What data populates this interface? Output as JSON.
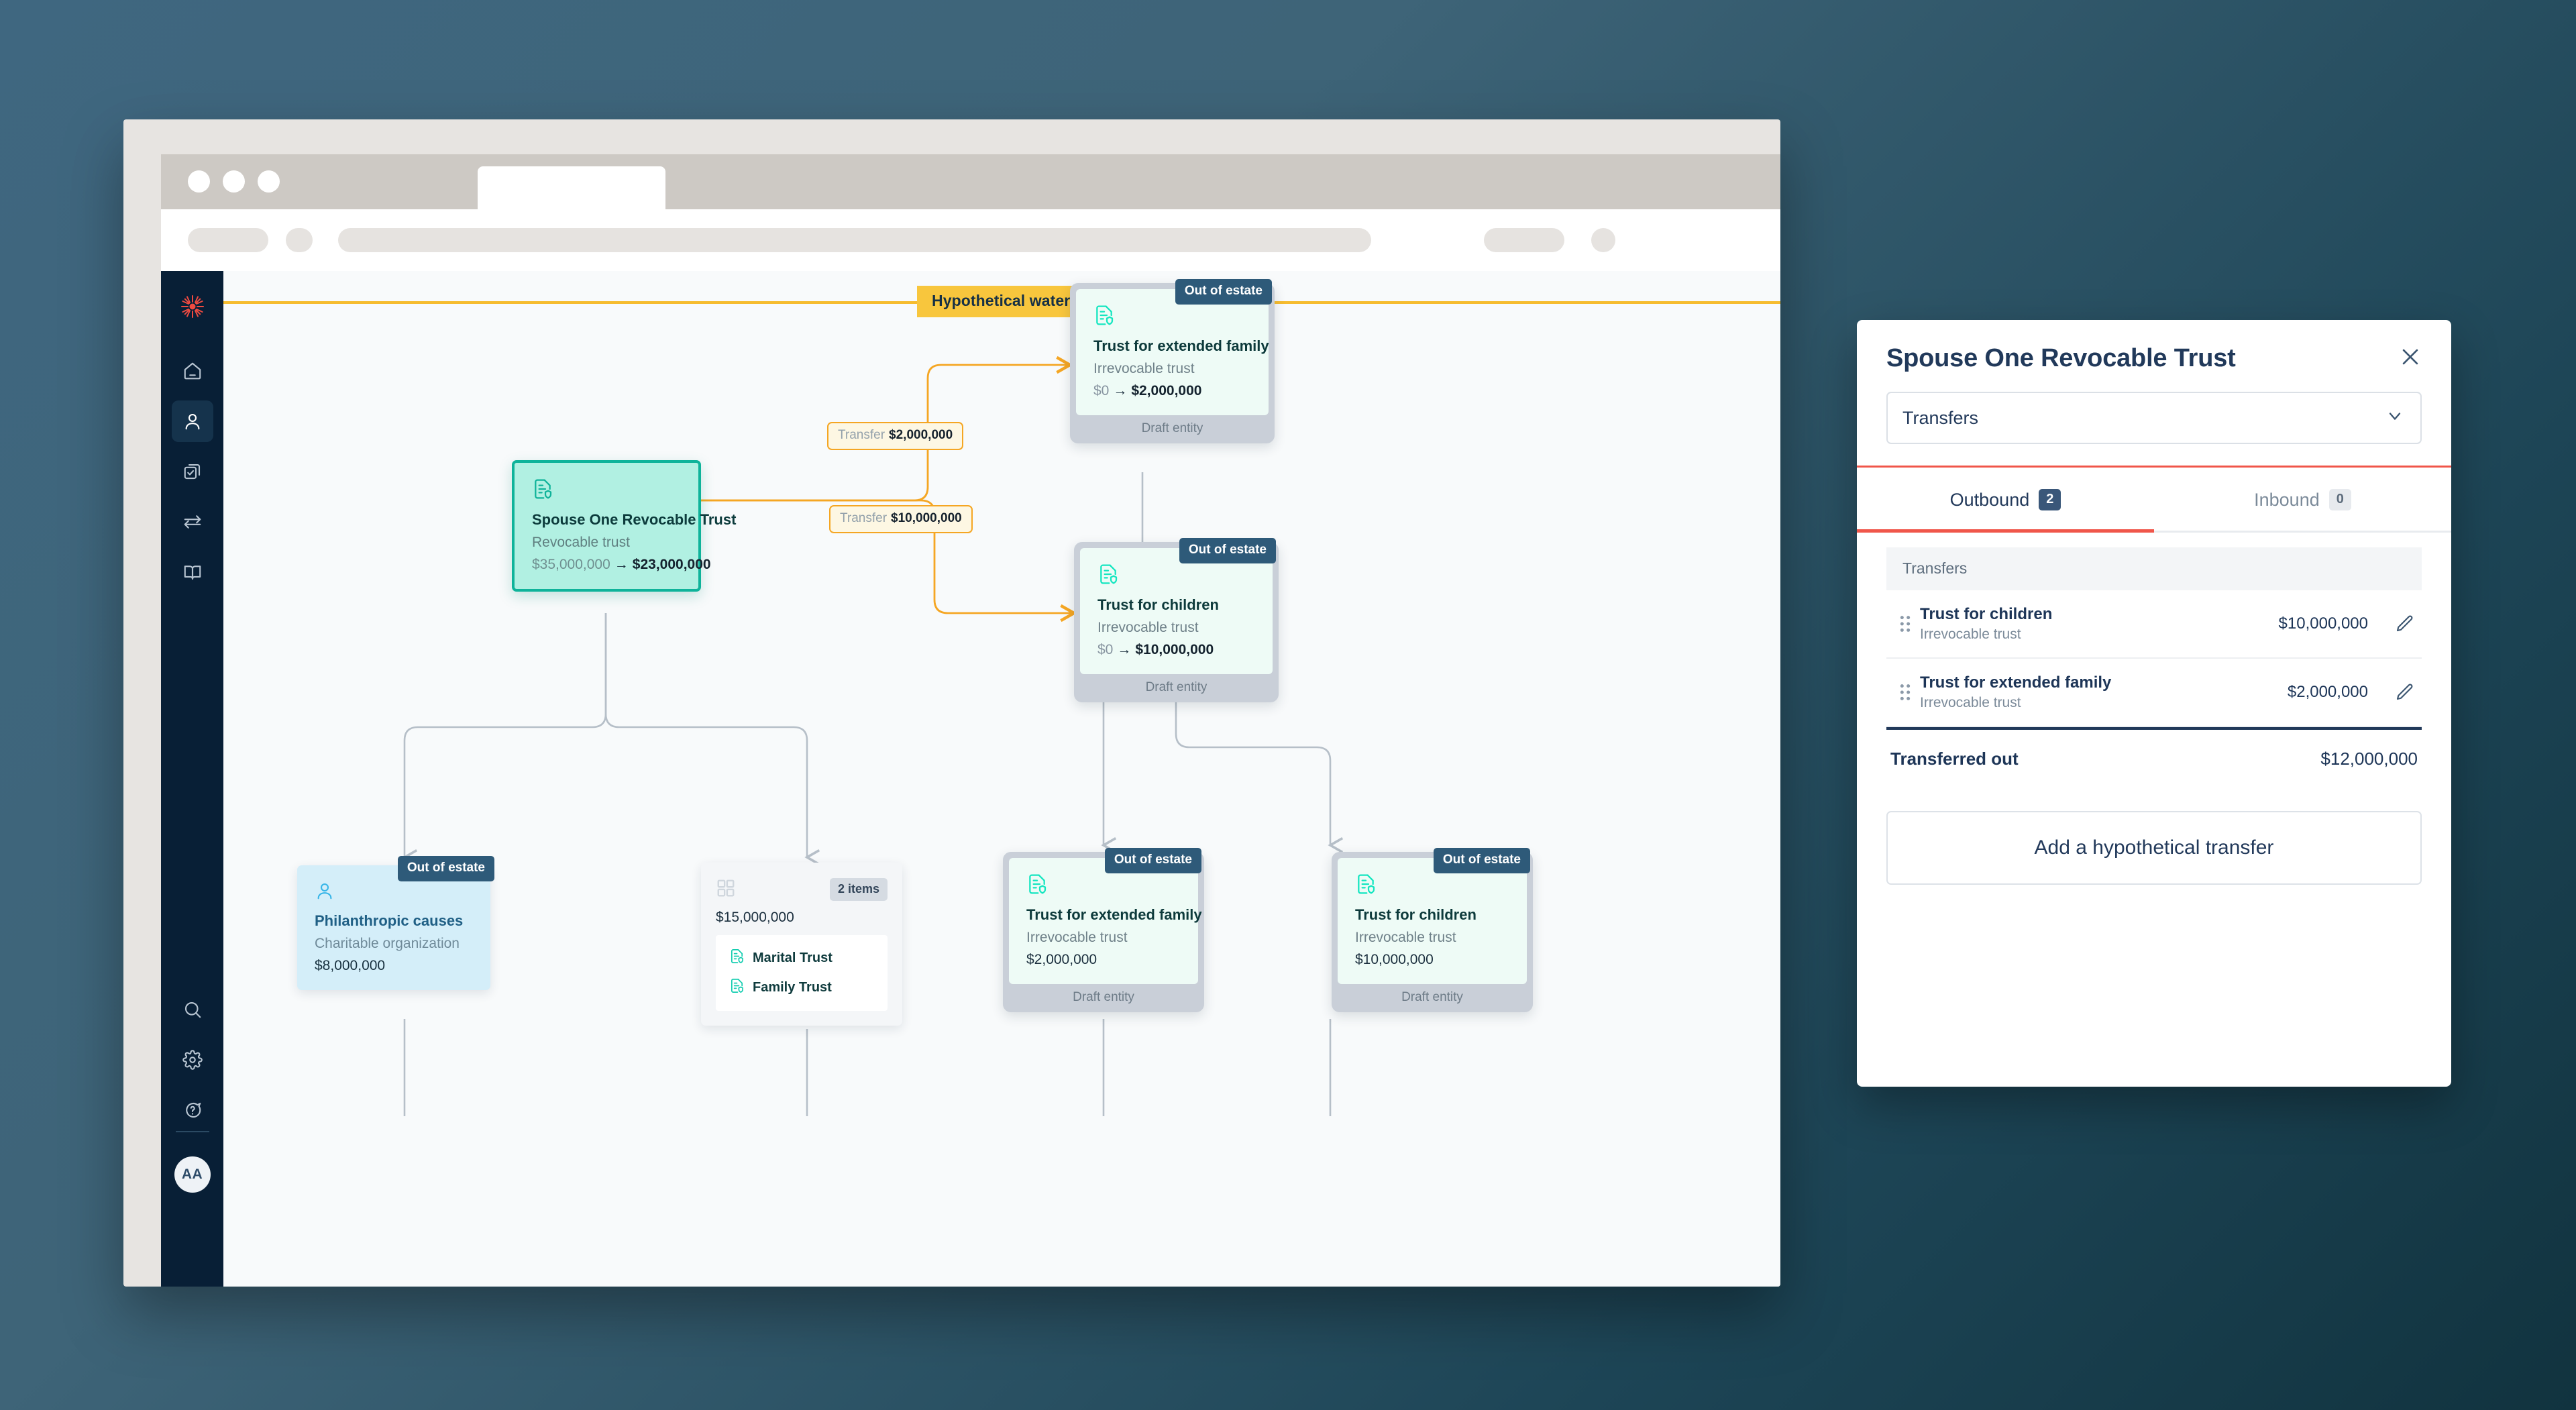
{
  "browser": {
    "dots": [
      "close-dot",
      "minimize-dot",
      "maximize-dot"
    ]
  },
  "sidebar": {
    "logo": "sunburst-logo",
    "items": [
      {
        "name": "home",
        "icon": "home-icon",
        "active": false
      },
      {
        "name": "clients",
        "icon": "person-icon",
        "active": true
      },
      {
        "name": "tasks",
        "icon": "copy-check-icon",
        "active": false
      },
      {
        "name": "transfers",
        "icon": "exchange-arrows-icon",
        "active": false
      },
      {
        "name": "library",
        "icon": "book-icon",
        "active": false
      }
    ],
    "utility": [
      {
        "name": "search",
        "icon": "search-icon"
      },
      {
        "name": "settings",
        "icon": "gear-icon"
      },
      {
        "name": "help",
        "icon": "question-chat-icon"
      }
    ],
    "avatar_initials": "AA"
  },
  "canvas": {
    "banner": "Hypothetical waterfall"
  },
  "diagram": {
    "root": {
      "title": "Spouse One Revocable Trust",
      "subtitle": "Revocable trust",
      "value_from": "$35,000,000",
      "value_arrow": "→",
      "value_to": "$23,000,000",
      "icon": "trust-document-icon"
    },
    "transfer_labels": [
      {
        "label": "Transfer",
        "amount": "$2,000,000"
      },
      {
        "label": "Transfer",
        "amount": "$10,000,000"
      }
    ],
    "transfer_targets": [
      {
        "title": "Trust for extended family",
        "subtitle": "Irrevocable trust",
        "value_from": "$0",
        "value_arrow": "→",
        "value_to": "$2,000,000",
        "badge": "Out of estate",
        "footer": "Draft entity",
        "icon": "trust-document-icon"
      },
      {
        "title": "Trust for children",
        "subtitle": "Irrevocable trust",
        "value_from": "$0",
        "value_arrow": "→",
        "value_to": "$10,000,000",
        "badge": "Out of estate",
        "footer": "Draft entity",
        "icon": "trust-document-icon"
      }
    ],
    "philanthropic": {
      "title": "Philanthropic causes",
      "subtitle": "Charitable organization",
      "value": "$8,000,000",
      "badge": "Out of estate",
      "icon": "person-icon"
    },
    "group": {
      "chip": "2 items",
      "amount": "$15,000,000",
      "icon": "grid-squares-icon",
      "items": [
        {
          "label": "Marital Trust",
          "icon": "trust-document-icon"
        },
        {
          "label": "Family Trust",
          "icon": "trust-document-icon"
        }
      ]
    },
    "beneficiaries": [
      {
        "title": "Trust for extended family",
        "subtitle": "Irrevocable trust",
        "value": "$2,000,000",
        "badge": "Out of estate",
        "footer": "Draft entity",
        "icon": "trust-document-icon"
      },
      {
        "title": "Trust for children",
        "subtitle": "Irrevocable trust",
        "value": "$10,000,000",
        "badge": "Out of estate",
        "footer": "Draft entity",
        "icon": "trust-document-icon"
      }
    ]
  },
  "panel": {
    "title": "Spouse One Revocable Trust",
    "close_icon": "close-icon",
    "select_value": "Transfers",
    "select_icon": "chevron-down-icon",
    "tabs": [
      {
        "label": "Outbound",
        "count": "2",
        "active": true
      },
      {
        "label": "Inbound",
        "count": "0",
        "active": false
      }
    ],
    "list_header": "Transfers",
    "rows": [
      {
        "name": "Trust for children",
        "subtitle": "Irrevocable trust",
        "amount": "$10,000,000",
        "drag_icon": "drag-handle-icon",
        "edit_icon": "pencil-icon"
      },
      {
        "name": "Trust for extended family",
        "subtitle": "Irrevocable trust",
        "amount": "$2,000,000",
        "drag_icon": "drag-handle-icon",
        "edit_icon": "pencil-icon"
      }
    ],
    "total_label": "Transferred out",
    "total_value": "$12,000,000",
    "add_button": "Add a hypothetical transfer"
  },
  "colors": {
    "accent_red": "#f0564a",
    "accent_yellow": "#f8c63d",
    "teal": "#0fb39a",
    "navy": "#22395a",
    "rail": "#081f36",
    "transfer_orange": "#f5a623"
  }
}
